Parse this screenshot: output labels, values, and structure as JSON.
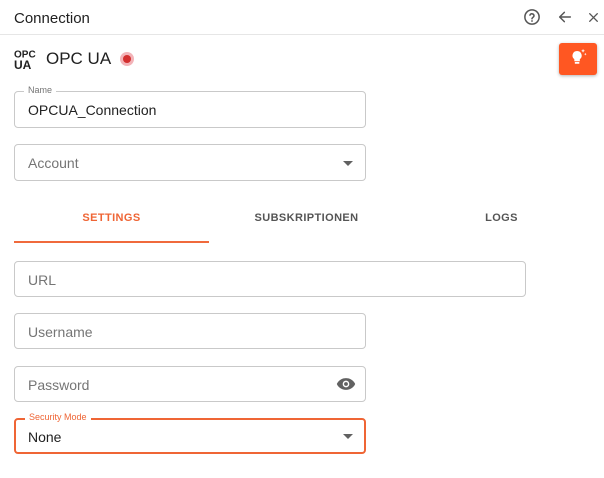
{
  "header": {
    "title": "Connection",
    "help_icon": "help-circle-icon",
    "back_icon": "arrow-left-icon",
    "close_icon": "close-icon"
  },
  "app": {
    "logo_icon": "opc-ua-logo",
    "logo_text": "OPC UA",
    "title": "OPC UA",
    "status_color": "#d32f2f",
    "tip_button_icon": "lightbulb-icon",
    "accent_color": "#ff5722"
  },
  "form": {
    "name": {
      "label": "Name",
      "value": "OPCUA_Connection"
    },
    "account": {
      "placeholder": "Account"
    }
  },
  "tabs": [
    {
      "label": "SETTINGS",
      "active": true
    },
    {
      "label": "SUBSKRIPTIONEN",
      "active": false
    },
    {
      "label": "LOGS",
      "active": false
    }
  ],
  "settings": {
    "url": {
      "placeholder": "URL"
    },
    "username": {
      "placeholder": "Username"
    },
    "password": {
      "placeholder": "Password",
      "icon": "eye-icon"
    },
    "security_mode": {
      "label": "Security Mode",
      "value": "None"
    }
  }
}
